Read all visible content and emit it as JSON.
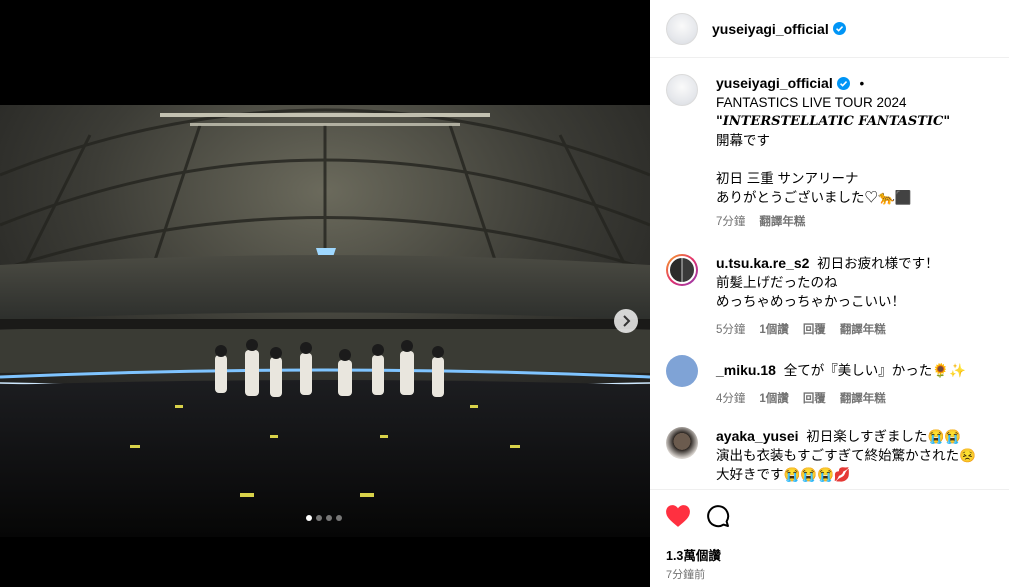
{
  "post": {
    "author": "yuseiyagi_official",
    "caption_lines": [
      "FANTASTICS LIVE TOUR 2024",
      "\"INTERSTELLATIC FANTASTIC\"",
      "開幕です",
      "",
      "初日 三重 サンアリーナ",
      "ありがとうございました♡🐆⬛"
    ],
    "dot": "•",
    "caption_time": "7分鐘",
    "caption_translate": "翻譯年糕",
    "likes": "1.3萬個讚",
    "time": "7分鐘前"
  },
  "comments": [
    {
      "user": "u.tsu.ka.re_s2",
      "lines": [
        "初日お疲れ様です！",
        "前髪上げだったのね",
        "めっちゃめっちゃかっこいい！"
      ],
      "time": "5分鐘",
      "likes": "1個讚",
      "reply": "回覆",
      "translate": "翻譯年糕"
    },
    {
      "user": "_miku.18",
      "lines": [
        "全てが『美しい』かった🌻✨"
      ],
      "time": "4分鐘",
      "likes": "1個讚",
      "reply": "回覆",
      "translate": "翻譯年糕"
    },
    {
      "user": "ayaka_yusei",
      "lines": [
        "初日楽しすぎました😭😭",
        "演出も衣装もすごすぎて終始驚かされた😣",
        "大好きです😭😭😭💋"
      ],
      "time": "",
      "likes": "",
      "reply": "",
      "translate": ""
    }
  ],
  "carousel": {
    "slides": 4,
    "active": 0
  },
  "colors": {
    "verified": "#0095f6",
    "like_red": "#ff3040",
    "meta_gray": "#737373",
    "miku_avatar": "#7fa3d6"
  },
  "icons": [
    "verified-badge-icon",
    "next-chevron-icon",
    "heart-icon",
    "comment-icon"
  ]
}
